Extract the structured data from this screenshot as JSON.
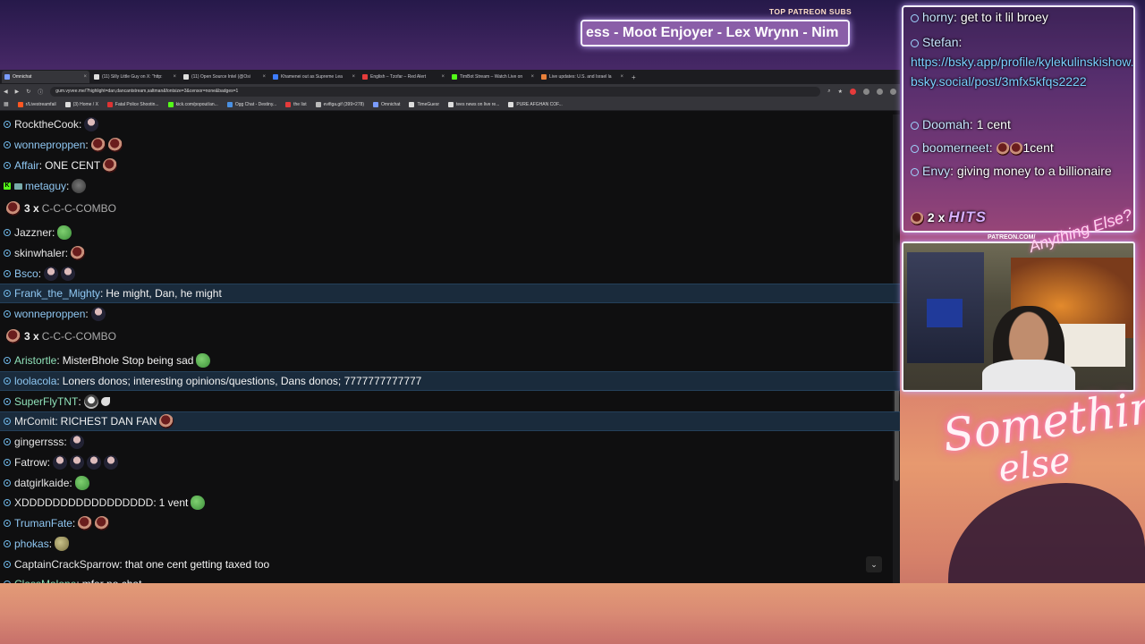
{
  "overlay": {
    "patreon_label": "TOP PATREON SUBS",
    "ticker_text": "ess - Moot Enjoyer - Lex Wrynn - Nim",
    "webcam_tag": "PATREON.COM/",
    "script_tag": "Anything Else?",
    "brand_line1": "Something",
    "brand_line2": "else"
  },
  "browser": {
    "tabs": [
      {
        "label": "Omnichat",
        "active": true,
        "color": "#7a9cff"
      },
      {
        "label": "(11) Silly Little Guy on X: \"http:",
        "active": false,
        "color": "#dddddd"
      },
      {
        "label": "(11) Open Source Intel (@Osi",
        "active": false,
        "color": "#dddddd"
      },
      {
        "label": "Khamenei out as Supreme Lea",
        "active": false,
        "color": "#3d7bff"
      },
      {
        "label": "English – Tzofar – Red Alert",
        "active": false,
        "color": "#e53b3b"
      },
      {
        "label": "TimBot Stream – Watch Live on",
        "active": false,
        "color": "#53fc18"
      },
      {
        "label": "Live updates: U.S. and Israel la",
        "active": false,
        "color": "#e8803a"
      }
    ],
    "new_tab": "+",
    "url": "gum.vyvee.me/?highlight=dan,dancantstream,saltman&fontsize=3&censor=none&badges=1",
    "bookmarks": [
      {
        "label": "r/Livestreamfail",
        "color": "#ff5722"
      },
      {
        "label": "(3) Home / X",
        "color": "#dddddd"
      },
      {
        "label": "Fatal Police Shootin...",
        "color": "#d33"
      },
      {
        "label": "kick.com/popout/an...",
        "color": "#53fc18"
      },
      {
        "label": "Ogg Chat - Destiny...",
        "color": "#4a90e2"
      },
      {
        "label": "the list",
        "color": "#e53b3b"
      },
      {
        "label": "evifiga.gif (399×278)",
        "color": "#bbbbbb"
      },
      {
        "label": "Omnichat",
        "color": "#7a9cff"
      },
      {
        "label": "TimeGuesr",
        "color": "#dddddd"
      },
      {
        "label": "tees news on live re...",
        "color": "#dddddd"
      },
      {
        "label": "PURE AFGHAN COF...",
        "color": "#dddddd"
      }
    ]
  },
  "chat": {
    "messages": [
      {
        "type": "msg",
        "user": "RocktheCook",
        "color": "#e6e6e6",
        "text": "",
        "emotes": [
          "gman"
        ]
      },
      {
        "type": "msg",
        "user": "wonneproppen",
        "color": "#8fc7f2",
        "text": "",
        "emotes": [
          "coin",
          "coin"
        ]
      },
      {
        "type": "msg",
        "user": "Affair",
        "color": "#8fc7f2",
        "text": "ONE CENT",
        "emotes": [
          "coin"
        ]
      },
      {
        "type": "msg",
        "user": "metaguy",
        "color": "#8fc7f2",
        "text": "",
        "emotes": [
          "dog"
        ],
        "kick": true
      },
      {
        "type": "combo",
        "count": "3 x",
        "text": "C-C-C-COMBO"
      },
      {
        "type": "msg",
        "user": "Jazzner",
        "color": "#e6e6e6",
        "text": "",
        "emotes": [
          "pepe"
        ]
      },
      {
        "type": "msg",
        "user": "skinwhaler",
        "color": "#e6e6e6",
        "text": "",
        "emotes": [
          "coin"
        ]
      },
      {
        "type": "msg",
        "user": "Bsco",
        "color": "#8fc7f2",
        "text": "",
        "emotes": [
          "gman",
          "gman"
        ]
      },
      {
        "type": "msg",
        "user": "Frank_the_Mighty",
        "color": "#8fc7f2",
        "text": "He might, Dan, he might",
        "emotes": [],
        "hl": true
      },
      {
        "type": "msg",
        "user": "wonneproppen",
        "color": "#8fc7f2",
        "text": "",
        "emotes": [
          "gman"
        ]
      },
      {
        "type": "combo",
        "count": "3 x",
        "text": "C-C-C-COMBO"
      },
      {
        "type": "msg",
        "user": "Aristortle",
        "color": "#8fe0b8",
        "text": "MisterBhole Stop being sad",
        "emotes": [
          "pepe"
        ]
      },
      {
        "type": "msg",
        "user": "loolacola",
        "color": "#8fc7f2",
        "text": "Loners donos; interesting opinions/questions, Dans donos; 7777777777777",
        "emotes": [],
        "hl": true
      },
      {
        "type": "msg",
        "user": "SuperFlyTNT",
        "color": "#8fe0b8",
        "text": "",
        "emotes": [
          "face",
          "small"
        ]
      },
      {
        "type": "msg",
        "user": "MrComit",
        "color": "#e6e6e6",
        "text": "RICHEST DAN FAN",
        "emotes": [
          "coin"
        ],
        "hl": true
      },
      {
        "type": "msg",
        "user": "gingerrsss",
        "color": "#e6e6e6",
        "text": "",
        "emotes": [
          "gman"
        ]
      },
      {
        "type": "msg",
        "user": "Fatrow",
        "color": "#e6e6e6",
        "text": "",
        "emotes": [
          "gman",
          "gman",
          "gman",
          "gman"
        ]
      },
      {
        "type": "msg",
        "user": "datgirlkaide",
        "color": "#e6e6e6",
        "text": "",
        "emotes": [
          "pepe"
        ]
      },
      {
        "type": "msg",
        "user": "XDDDDDDDDDDDDDDDDD",
        "color": "#e6e6e6",
        "text": "1 vent",
        "emotes": [
          "pepe"
        ]
      },
      {
        "type": "msg",
        "user": "TrumanFate",
        "color": "#8fc7f2",
        "text": "",
        "emotes": [
          "coin",
          "coin"
        ]
      },
      {
        "type": "msg",
        "user": "phokas",
        "color": "#8fc7f2",
        "text": "",
        "emotes": [
          "egg"
        ]
      },
      {
        "type": "msg",
        "user": "CaptainCrackSparrow",
        "color": "#e6e6e6",
        "text": "that one cent getting taxed too",
        "emotes": []
      },
      {
        "type": "msg",
        "user": "ClassMalone",
        "color": "#8fe0b8",
        "text": "mfer no chat",
        "emotes": []
      }
    ],
    "scroll_down_icon": "⌄"
  },
  "side_chat": {
    "messages": [
      {
        "user": "horny",
        "text": "get to it lil broey"
      },
      {
        "user": "Stefan",
        "text": ""
      },
      {
        "link": "https://bsky.app/profile/kylekulinskishow.bsky.social/post/3mfx5kfqs2222"
      },
      {
        "user": "Doomah",
        "text": "1 cent"
      },
      {
        "user": "boomerneet",
        "text": "1cent"
      },
      {
        "user": "Envy",
        "text": "giving money to a billionaire"
      },
      {
        "combo_count": "2 x",
        "combo_text": "HITS"
      }
    ]
  }
}
